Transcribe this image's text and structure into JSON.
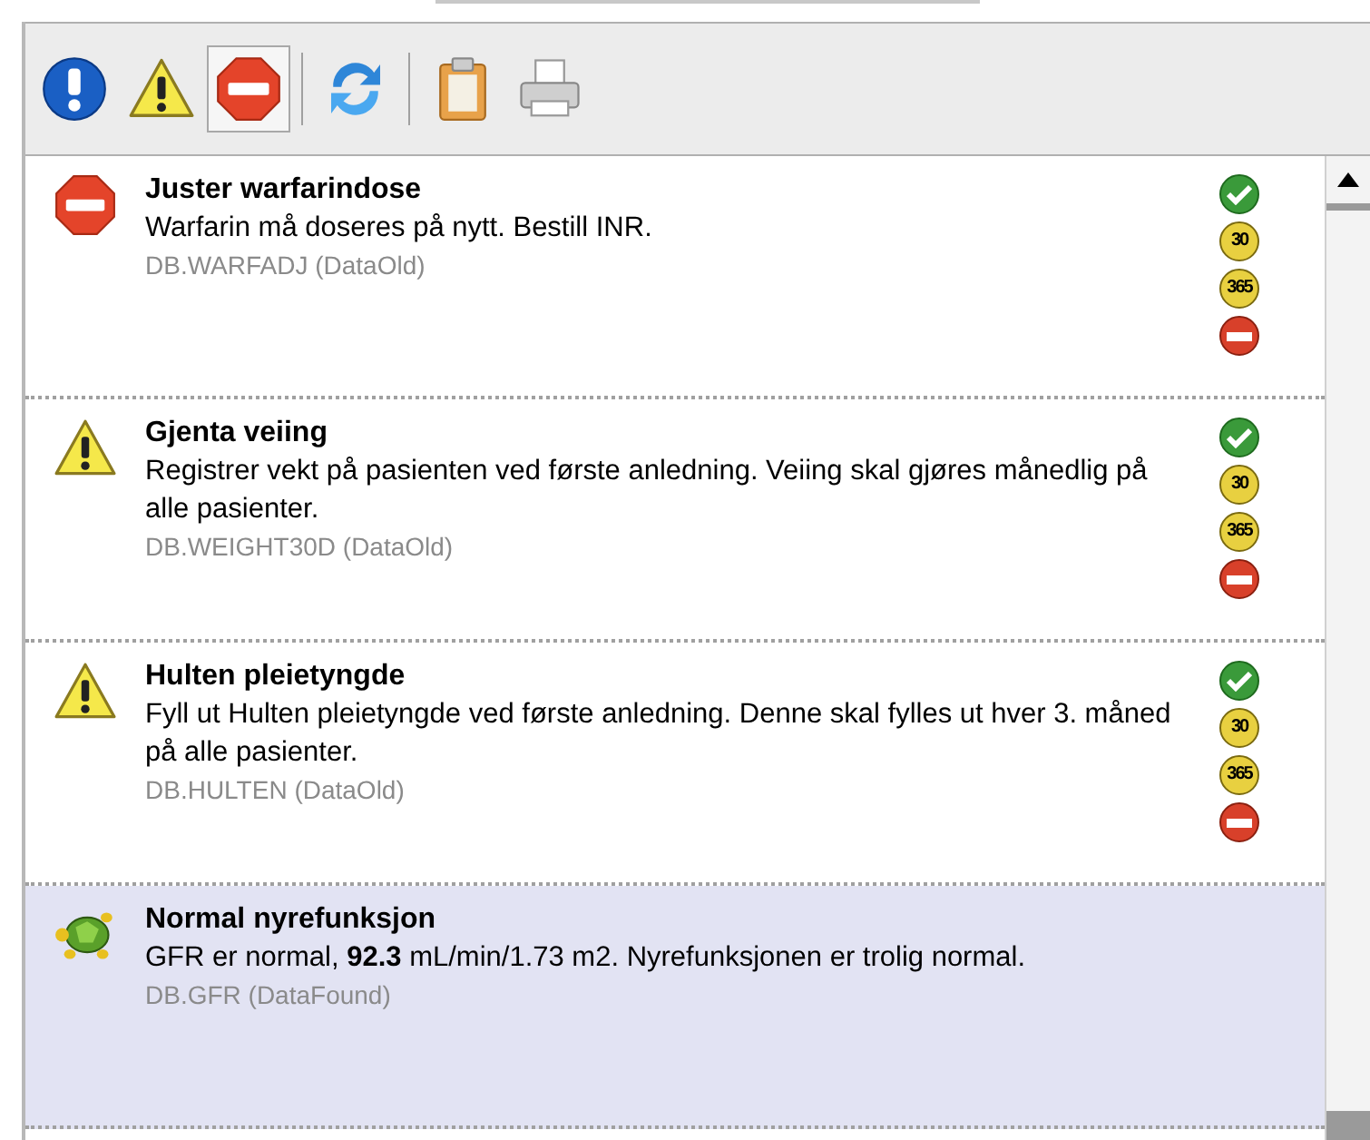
{
  "toolbar": [
    {
      "kind": "info",
      "selected": false
    },
    {
      "kind": "warning",
      "selected": false
    },
    {
      "kind": "stop",
      "selected": true
    },
    {
      "kind": "separator"
    },
    {
      "kind": "refresh",
      "selected": false
    },
    {
      "kind": "separator"
    },
    {
      "kind": "clipboard",
      "selected": false
    },
    {
      "kind": "print",
      "selected": false
    }
  ],
  "items": [
    {
      "kind": "stop",
      "title": "Juster warfarindose",
      "text": "Warfarin må doseres på nytt. Bestill INR.",
      "source": "DB.WARFADJ (DataOld)",
      "selected": false,
      "actions": [
        {
          "kind": "accept"
        },
        {
          "kind": "days",
          "label": "30"
        },
        {
          "kind": "days",
          "label": "365"
        },
        {
          "kind": "reject"
        }
      ]
    },
    {
      "kind": "warning",
      "title": "Gjenta veiing",
      "text": "Registrer vekt på pasienten ved første anledning. Veiing skal gjøres månedlig på alle pasienter.",
      "source": "DB.WEIGHT30D (DataOld)",
      "selected": false,
      "actions": [
        {
          "kind": "accept"
        },
        {
          "kind": "days",
          "label": "30"
        },
        {
          "kind": "days",
          "label": "365"
        },
        {
          "kind": "reject"
        }
      ]
    },
    {
      "kind": "warning",
      "title": "Hulten pleietyngde",
      "text": "Fyll ut Hulten pleietyngde ved første anledning. Denne skal fylles ut hver 3. måned på alle pasienter.",
      "source": "DB.HULTEN (DataOld)",
      "selected": false,
      "actions": [
        {
          "kind": "accept"
        },
        {
          "kind": "days",
          "label": "30"
        },
        {
          "kind": "days",
          "label": "365"
        },
        {
          "kind": "reject"
        }
      ]
    },
    {
      "kind": "turtle",
      "title": "Normal nyrefunksjon",
      "text": "GFR er normal, **92.3** mL/min/1.73 m2. Nyrefunksjonen er trolig normal.",
      "source": "DB.GFR (DataFound)",
      "selected": true
    }
  ]
}
